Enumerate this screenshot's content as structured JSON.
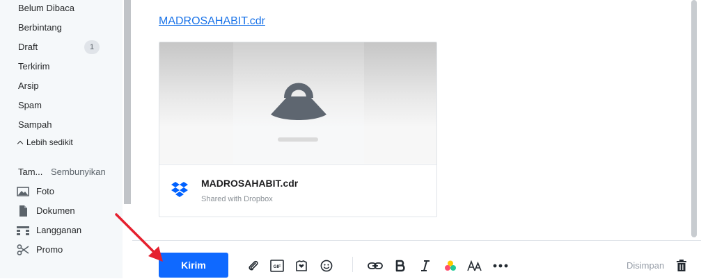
{
  "sidebar": {
    "folders": [
      {
        "label": "Belum Dibaca"
      },
      {
        "label": "Berbintang"
      },
      {
        "label": "Draft",
        "badge": "1"
      },
      {
        "label": "Terkirim"
      },
      {
        "label": "Arsip"
      },
      {
        "label": "Spam"
      },
      {
        "label": "Sampah"
      }
    ],
    "less_label": "Lebih sedikit",
    "views_heading": "Tam...",
    "views_hide": "Sembunyikan",
    "views": [
      {
        "label": "Foto",
        "icon": "photo-icon"
      },
      {
        "label": "Dokumen",
        "icon": "document-icon"
      },
      {
        "label": "Langganan",
        "icon": "subscriptions-icon"
      },
      {
        "label": "Promo",
        "icon": "scissors-icon"
      }
    ]
  },
  "compose": {
    "attachment_link": "MADROSAHABIT.cdr",
    "card": {
      "file_name": "MADROSAHABIT.cdr",
      "subtitle": "Shared with Dropbox",
      "icon": "dropbox-icon"
    }
  },
  "toolbar": {
    "send_label": "Kirim",
    "saved_label": "Disimpan",
    "gif_label": "GIF",
    "icons": [
      "attach-icon",
      "gif-icon",
      "sticker-icon",
      "emoji-icon",
      "link-icon",
      "bold-icon",
      "italic-icon",
      "color-icon",
      "font-size-icon",
      "more-icon",
      "delete-icon"
    ]
  },
  "colors": {
    "accent": "#0f69ff",
    "link": "#1a73e8",
    "annotation_arrow": "#e5202e"
  }
}
